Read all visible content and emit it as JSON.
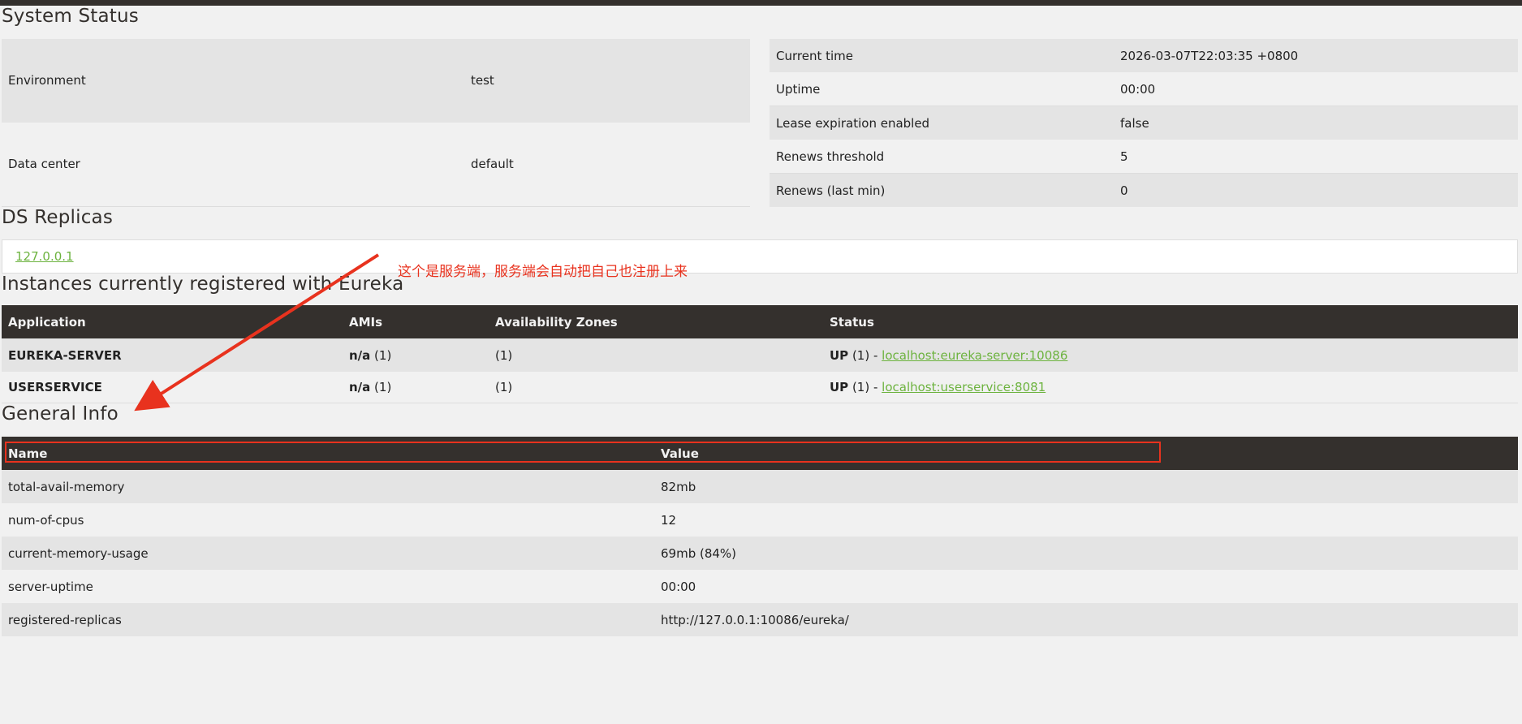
{
  "system_status": {
    "title": "System Status",
    "left": [
      {
        "label": "Environment",
        "value": "test"
      },
      {
        "label": "Data center",
        "value": "default"
      }
    ],
    "right": [
      {
        "label": "Current time",
        "value": "2026-03-07T22:03:35 +0800"
      },
      {
        "label": "Uptime",
        "value": "00:00"
      },
      {
        "label": "Lease expiration enabled",
        "value": "false"
      },
      {
        "label": "Renews threshold",
        "value": "5"
      },
      {
        "label": "Renews (last min)",
        "value": "0"
      }
    ]
  },
  "ds_replicas": {
    "title": "DS Replicas",
    "replica_link": "127.0.0.1"
  },
  "instances": {
    "title": "Instances currently registered with Eureka",
    "headers": [
      "Application",
      "AMIs",
      "Availability Zones",
      "Status"
    ],
    "rows": [
      {
        "application": "EUREKA-SERVER",
        "ami_strong": "n/a",
        "ami_count": " (1)",
        "zones": "(1)",
        "status_strong": "UP",
        "status_count": " (1) - ",
        "status_link": "localhost:eureka-server:10086"
      },
      {
        "application": "USERSERVICE",
        "ami_strong": "n/a",
        "ami_count": " (1)",
        "zones": "(1)",
        "status_strong": "UP",
        "status_count": " (1) - ",
        "status_link": "localhost:userservice:8081"
      }
    ]
  },
  "general_info": {
    "title": "General Info",
    "headers": [
      "Name",
      "Value"
    ],
    "rows": [
      {
        "name": "total-avail-memory",
        "value": "82mb"
      },
      {
        "name": "num-of-cpus",
        "value": "12"
      },
      {
        "name": "current-memory-usage",
        "value": "69mb (84%)"
      },
      {
        "name": "server-uptime",
        "value": "00:00"
      },
      {
        "name": "registered-replicas",
        "value": "http://127.0.0.1:10086/eureka/"
      }
    ]
  },
  "annotation": {
    "text": "这个是服务端，服务端会自动把自己也注册上来",
    "color": "#e8321e"
  },
  "colors": {
    "header_dark": "#34302d",
    "link_green": "#6db33f",
    "row_alt": "#e4e4e4",
    "background": "#f1f1f1"
  }
}
